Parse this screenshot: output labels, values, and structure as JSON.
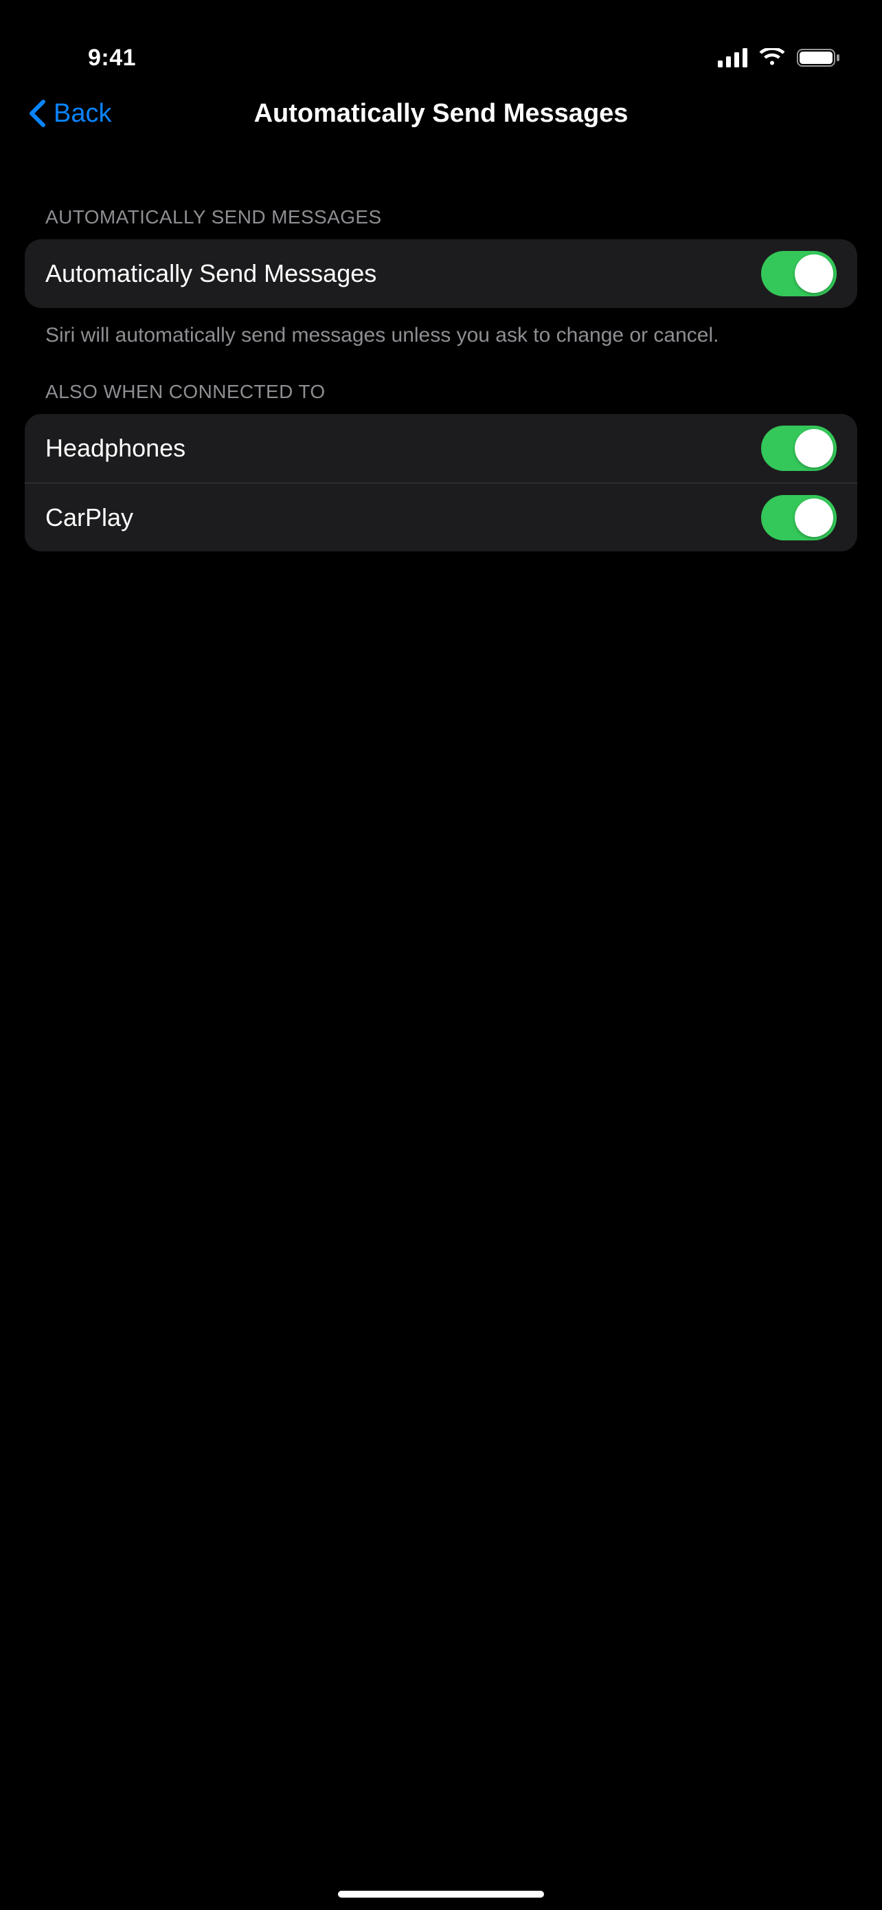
{
  "status": {
    "time": "9:41"
  },
  "nav": {
    "back_label": "Back",
    "title": "Automatically Send Messages"
  },
  "section1": {
    "header": "AUTOMATICALLY SEND MESSAGES",
    "row_label": "Automatically Send Messages",
    "row_on": true,
    "footer": "Siri will automatically send messages unless you ask to change or cancel."
  },
  "section2": {
    "header": "ALSO WHEN CONNECTED TO",
    "rows": [
      {
        "label": "Headphones",
        "on": true
      },
      {
        "label": "CarPlay",
        "on": true
      }
    ]
  }
}
